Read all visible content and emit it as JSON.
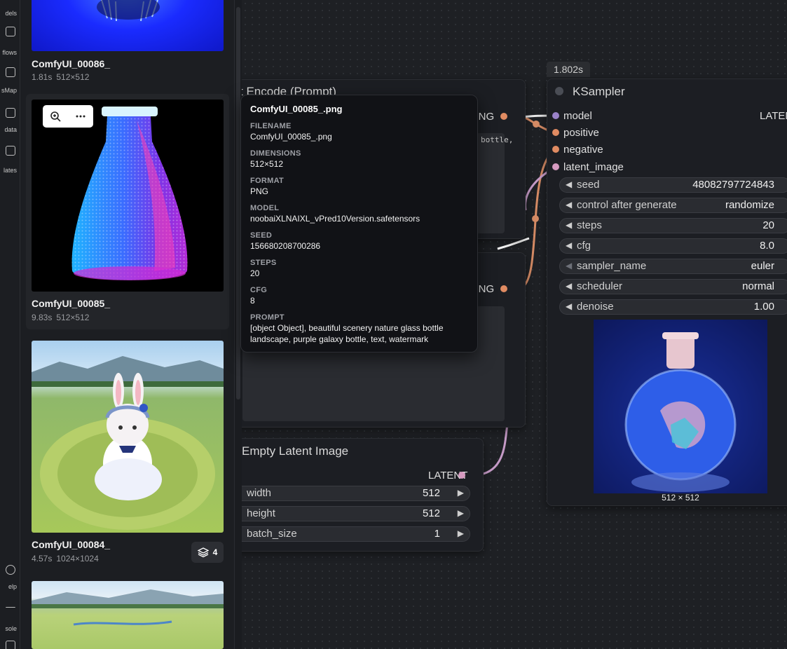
{
  "rail": {
    "items": [
      {
        "label": "dels",
        "icon": "models-icon"
      },
      {
        "label": "flows",
        "icon": "workflows-icon"
      },
      {
        "label": "sMap",
        "icon": "nodes-map-icon"
      },
      {
        "label": "data",
        "icon": "data-icon"
      },
      {
        "label": "lates",
        "icon": "templates-icon"
      },
      {
        "label": "elp",
        "icon": "help-icon"
      },
      {
        "label": "sole",
        "icon": "console-icon"
      }
    ]
  },
  "gallery": {
    "items": [
      {
        "title": "ComfyUI_00086_",
        "time": "1.81s",
        "size": "512×512"
      },
      {
        "title": "ComfyUI_00085_",
        "time": "9.83s",
        "size": "512×512"
      },
      {
        "title": "ComfyUI_00084_",
        "time": "4.57s",
        "size": "1024×1024",
        "stack_count": "4"
      }
    ],
    "zoom_icon": "zoom-in-icon",
    "more_icon": "more-horizontal-icon"
  },
  "tooltip": {
    "filename_title": "ComfyUI_00085_.png",
    "fields": [
      {
        "label": "FILENAME",
        "value": "ComfyUI_00085_.png"
      },
      {
        "label": "DIMENSIONS",
        "value": "512×512"
      },
      {
        "label": "FORMAT",
        "value": "PNG"
      },
      {
        "label": "MODEL",
        "value": "noobaiXLNAIXL_vPred10Version.safetensors"
      },
      {
        "label": "SEED",
        "value": "156680208700286"
      },
      {
        "label": "STEPS",
        "value": "20"
      },
      {
        "label": "CFG",
        "value": "8"
      },
      {
        "label": "PROMPT",
        "value": "[object Object], beautiful scenery nature glass bottle landscape, purple galaxy bottle, text, watermark"
      }
    ]
  },
  "nodes": {
    "clip_top": {
      "title": "t Encode (Prompt)",
      "output": "CONDITIONING",
      "output_visible": "ONING",
      "text_peek": "bottle,"
    },
    "clip_bottom": {
      "output_visible": "ONING"
    },
    "empty_latent": {
      "title": "Empty Latent Image",
      "output": "LATENT",
      "widgets": [
        {
          "name": "width",
          "value": "512"
        },
        {
          "name": "height",
          "value": "512"
        },
        {
          "name": "batch_size",
          "value": "1"
        }
      ]
    },
    "ksampler": {
      "time": "1.802s",
      "title": "KSampler",
      "inputs": [
        "model",
        "positive",
        "negative",
        "latent_image"
      ],
      "output": "LATEN",
      "widgets": [
        {
          "name": "seed",
          "value": "48082797724843"
        },
        {
          "name": "control after generate",
          "value": "randomize"
        },
        {
          "name": "steps",
          "value": "20"
        },
        {
          "name": "cfg",
          "value": "8.0"
        },
        {
          "name": "sampler_name",
          "value": "euler"
        },
        {
          "name": "scheduler",
          "value": "normal"
        },
        {
          "name": "denoise",
          "value": "1.00"
        }
      ],
      "preview_size": "512 × 512"
    }
  },
  "colors": {
    "port_model": "#9a82c8",
    "port_conditioning": "#e08b62",
    "port_latent": "#d69ac0",
    "link_conditioning": "#d48a64",
    "link_latent": "#c59ac6"
  }
}
